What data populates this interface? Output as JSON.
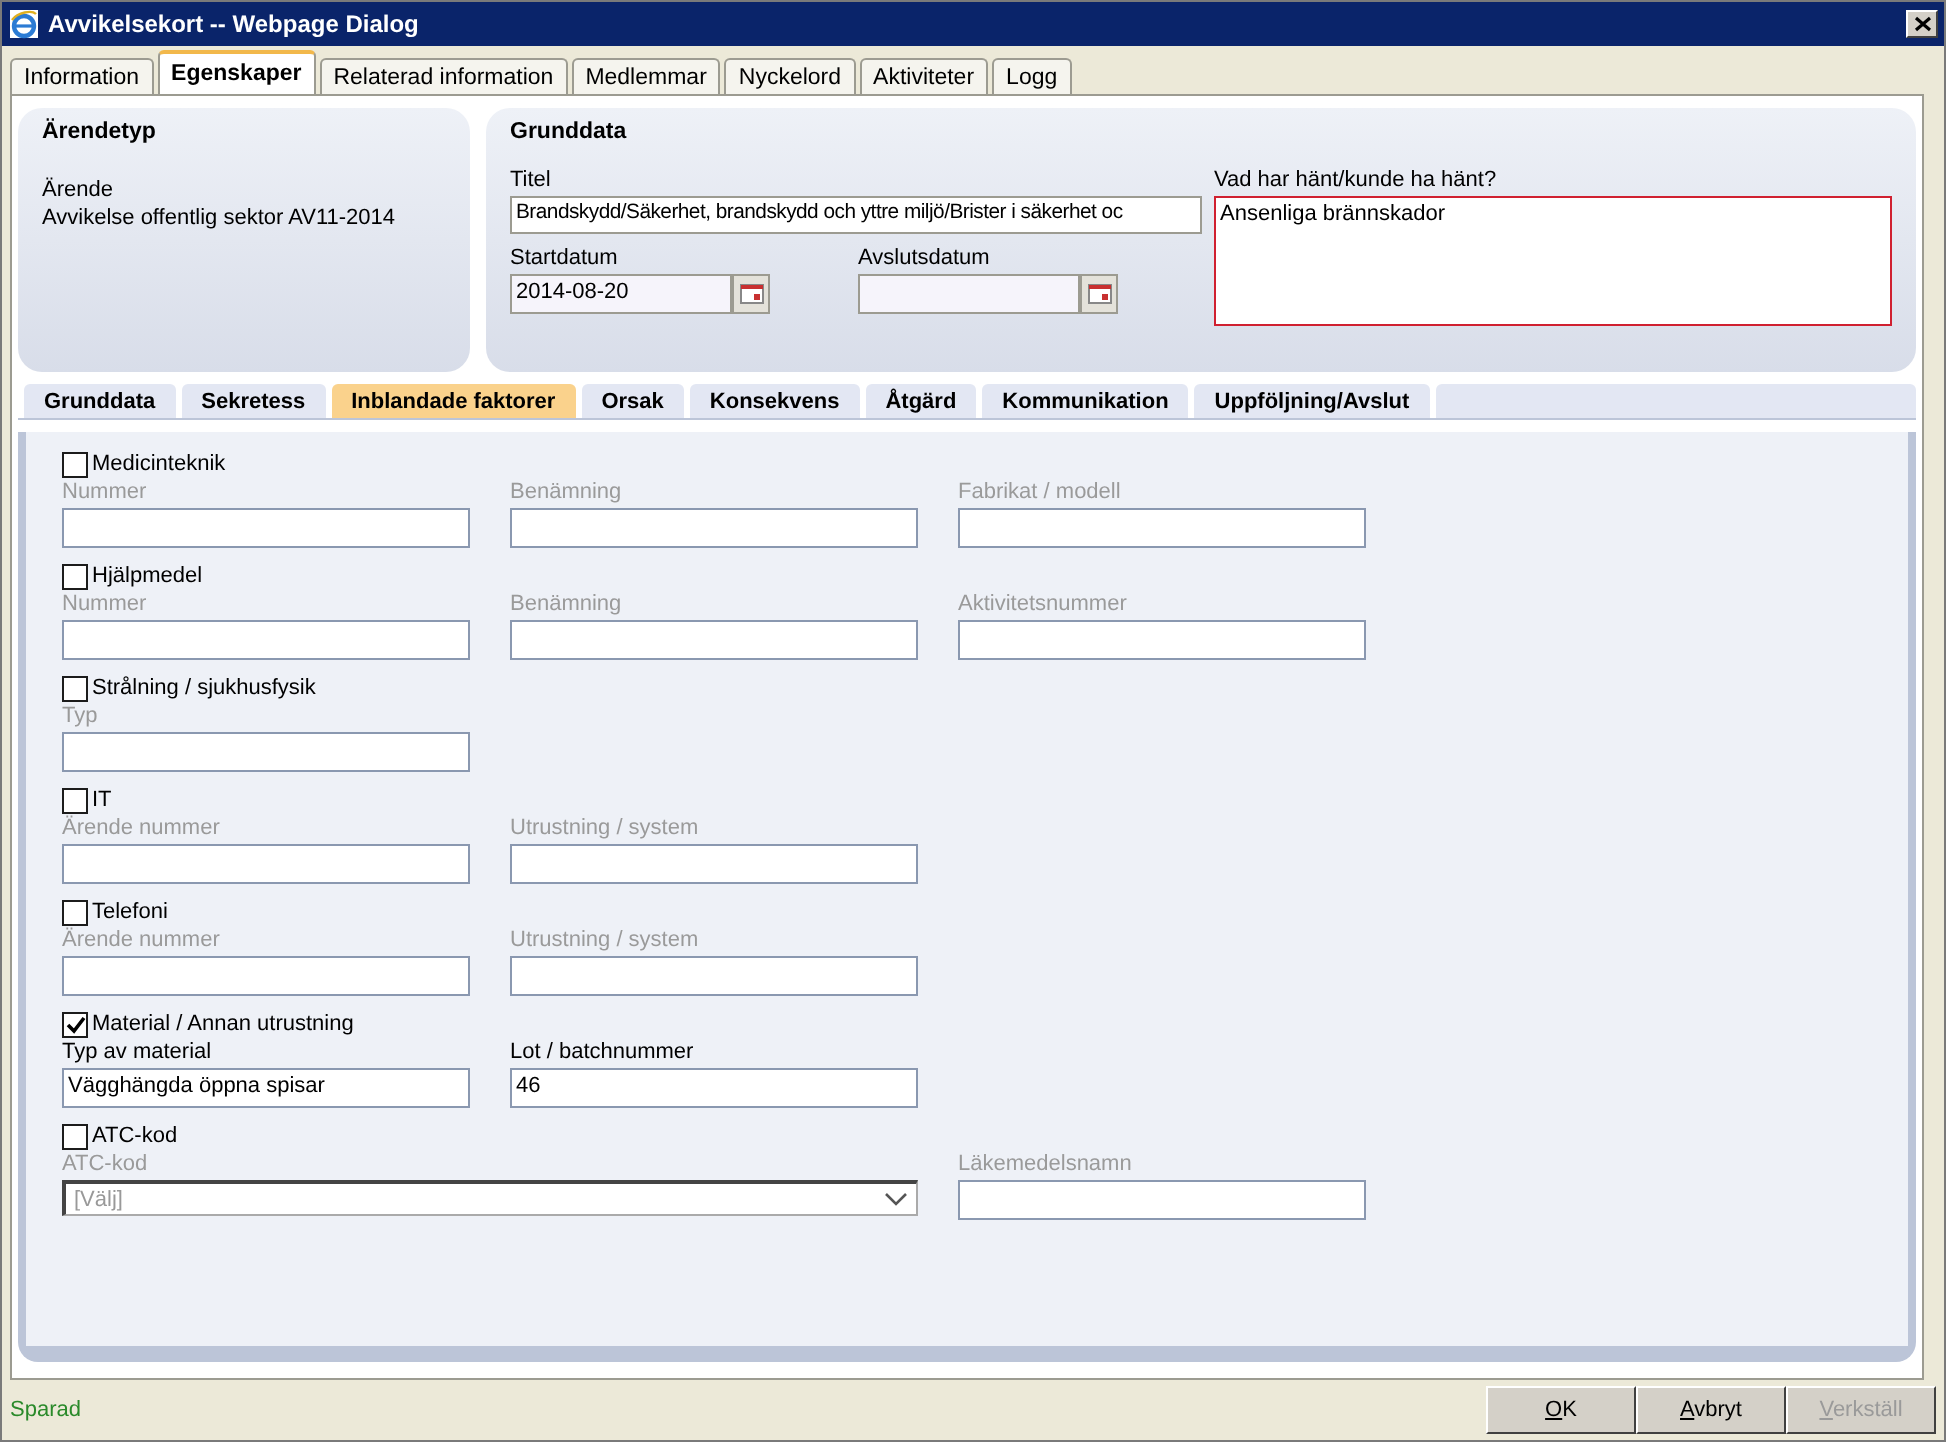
{
  "window": {
    "title": "Avvikelsekort -- Webpage Dialog"
  },
  "tabs": [
    {
      "label": "Information",
      "selected": false
    },
    {
      "label": "Egenskaper",
      "selected": true
    },
    {
      "label": "Relaterad information",
      "selected": false
    },
    {
      "label": "Medlemmar",
      "selected": false
    },
    {
      "label": "Nyckelord",
      "selected": false
    },
    {
      "label": "Aktiviteter",
      "selected": false
    },
    {
      "label": "Logg",
      "selected": false
    }
  ],
  "case_type": {
    "heading": "Ärendetyp",
    "label": "Ärende",
    "value": "Avvikelse offentlig sektor AV11-2014"
  },
  "basic_data": {
    "heading": "Grunddata",
    "title": {
      "label": "Titel",
      "value": "Brandskydd/Säkerhet, brandskydd och yttre miljö/Brister i säkerhet oc"
    },
    "start_date": {
      "label": "Startdatum",
      "value": "2014-08-20"
    },
    "end_date": {
      "label": "Avslutsdatum"
    },
    "what_happened": {
      "label": "Vad har hänt/kunde ha hänt?",
      "value": "Ansenliga brännskador"
    }
  },
  "sub_tabs": [
    {
      "label": "Grunddata",
      "selected": false
    },
    {
      "label": "Sekretess",
      "selected": false
    },
    {
      "label": "Inblandade faktorer",
      "selected": true
    },
    {
      "label": "Orsak",
      "selected": false
    },
    {
      "label": "Konsekvens",
      "selected": false
    },
    {
      "label": "Åtgärd",
      "selected": false
    },
    {
      "label": "Kommunikation",
      "selected": false
    },
    {
      "label": "Uppföljning/Avslut",
      "selected": false
    }
  ],
  "sections": [
    {
      "label": "Medicinteknik",
      "checked": false,
      "fields": [
        {
          "kind": "text",
          "label": "Nummer"
        },
        {
          "kind": "text",
          "label": "Benämning"
        },
        {
          "kind": "text",
          "label": "Fabrikat / modell"
        }
      ]
    },
    {
      "label": "Hjälpmedel",
      "checked": false,
      "fields": [
        {
          "kind": "text",
          "label": "Nummer"
        },
        {
          "kind": "text",
          "label": "Benämning"
        },
        {
          "kind": "text",
          "label": "Aktivitetsnummer"
        }
      ]
    },
    {
      "label": "Strålning / sjukhusfysik",
      "checked": false,
      "fields": [
        {
          "kind": "text",
          "label": "Typ"
        }
      ]
    },
    {
      "label": "IT",
      "checked": false,
      "fields": [
        {
          "kind": "text",
          "label": "Ärende nummer"
        },
        {
          "kind": "text",
          "label": "Utrustning / system"
        }
      ]
    },
    {
      "label": "Telefoni",
      "checked": false,
      "fields": [
        {
          "kind": "text",
          "label": "Ärende nummer"
        },
        {
          "kind": "text",
          "label": "Utrustning / system"
        }
      ]
    },
    {
      "label": "Material / Annan utrustning",
      "checked": true,
      "fields": [
        {
          "kind": "text",
          "label": "Typ av material",
          "value": "Vägghängda öppna spisar"
        },
        {
          "kind": "text",
          "label": "Lot / batchnummer",
          "value": "46"
        }
      ]
    },
    {
      "label": "ATC-kod",
      "checked": false,
      "fields": [
        {
          "kind": "select",
          "label": "ATC-kod",
          "placeholder": "[Välj]"
        },
        {
          "kind": "text",
          "label": "Läkemedelsnamn"
        }
      ]
    }
  ],
  "status": "Sparad",
  "buttons": [
    {
      "label": "OK",
      "disabled": false
    },
    {
      "label": "Avbryt",
      "disabled": false
    },
    {
      "label": "Verkställ",
      "disabled": true
    }
  ]
}
